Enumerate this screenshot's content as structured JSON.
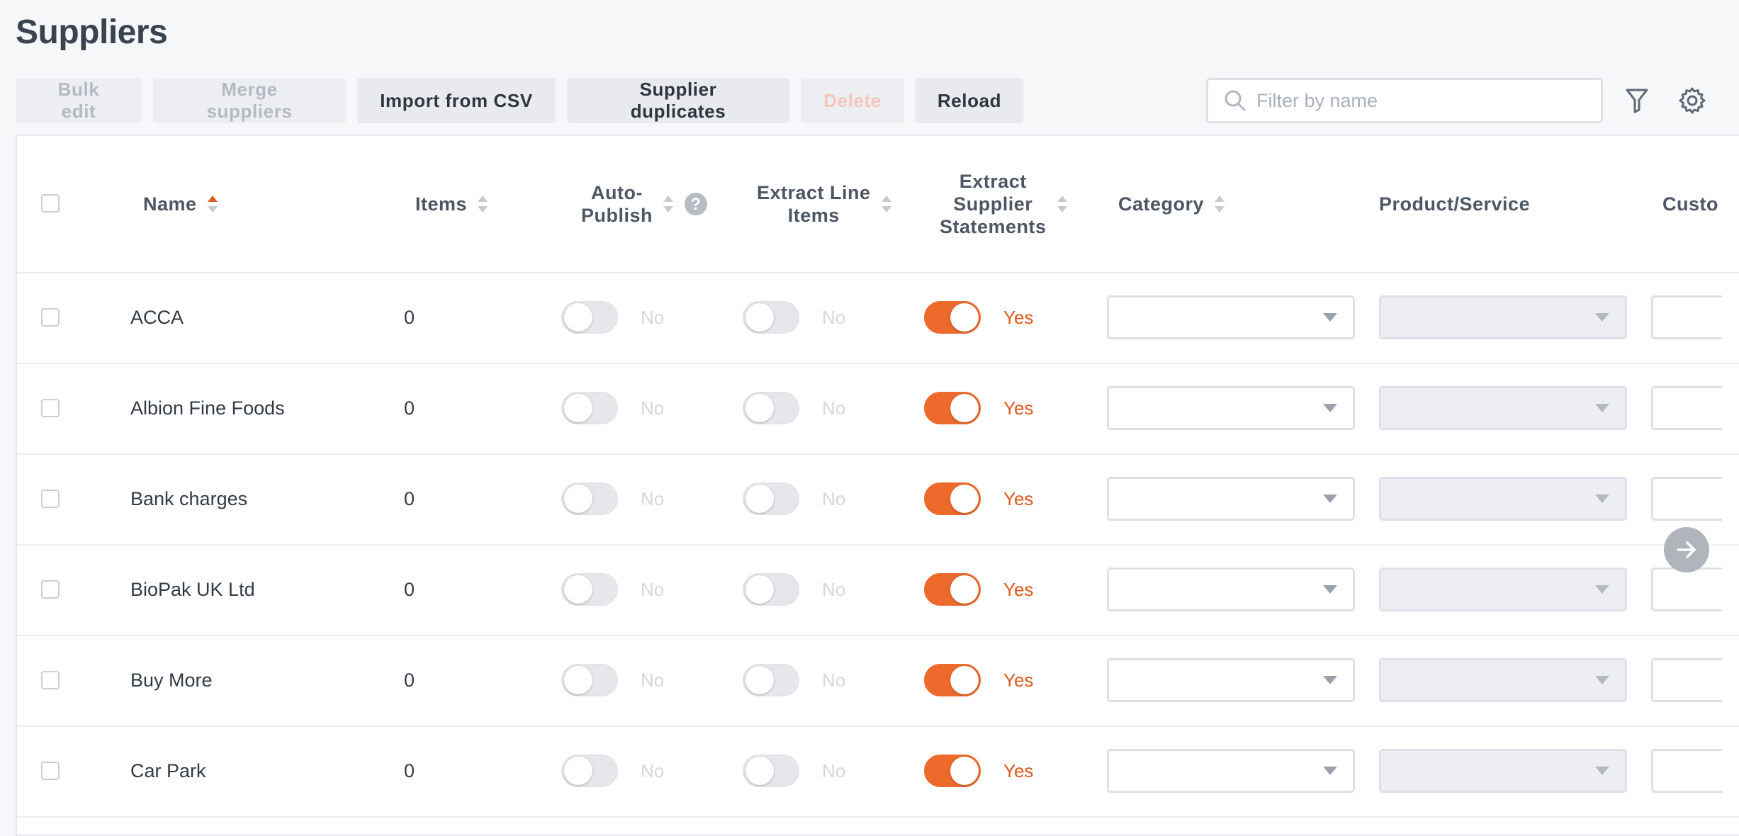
{
  "page_title": "Suppliers",
  "toolbar": {
    "bulk_edit": "Bulk edit",
    "merge_suppliers": "Merge suppliers",
    "import_csv": "Import from CSV",
    "supplier_duplicates": "Supplier duplicates",
    "delete": "Delete",
    "reload": "Reload"
  },
  "search": {
    "placeholder": "Filter by name",
    "value": ""
  },
  "columns": {
    "name": "Name",
    "items": "Items",
    "auto_publish_1": "Auto-",
    "auto_publish_2": "Publish",
    "extract_line_1": "Extract Line",
    "extract_line_2": "Items",
    "extract_stmt_1": "Extract",
    "extract_stmt_2": "Supplier",
    "extract_stmt_3": "Statements",
    "category": "Category",
    "product_service": "Product/Service",
    "custom": "Custo"
  },
  "sort": {
    "column": "Name",
    "direction": "ascending"
  },
  "colors": {
    "accent": "#ec6a2c",
    "accent_text": "#e2581c"
  },
  "rows": [
    {
      "name": "ACCA",
      "items": "0",
      "auto_publish": "No",
      "extract_line_items": "No",
      "extract_statements": "Yes"
    },
    {
      "name": "Albion Fine Foods",
      "items": "0",
      "auto_publish": "No",
      "extract_line_items": "No",
      "extract_statements": "Yes"
    },
    {
      "name": "Bank charges",
      "items": "0",
      "auto_publish": "No",
      "extract_line_items": "No",
      "extract_statements": "Yes"
    },
    {
      "name": "BioPak UK Ltd",
      "items": "0",
      "auto_publish": "No",
      "extract_line_items": "No",
      "extract_statements": "Yes"
    },
    {
      "name": "Buy More",
      "items": "0",
      "auto_publish": "No",
      "extract_line_items": "No",
      "extract_statements": "Yes"
    },
    {
      "name": "Car Park",
      "items": "0",
      "auto_publish": "No",
      "extract_line_items": "No",
      "extract_statements": "Yes"
    }
  ],
  "icons": {
    "search": "search-icon",
    "filter": "filter-icon",
    "settings": "gear-icon",
    "help": "help-icon",
    "scroll_right": "arrow-right-icon"
  }
}
